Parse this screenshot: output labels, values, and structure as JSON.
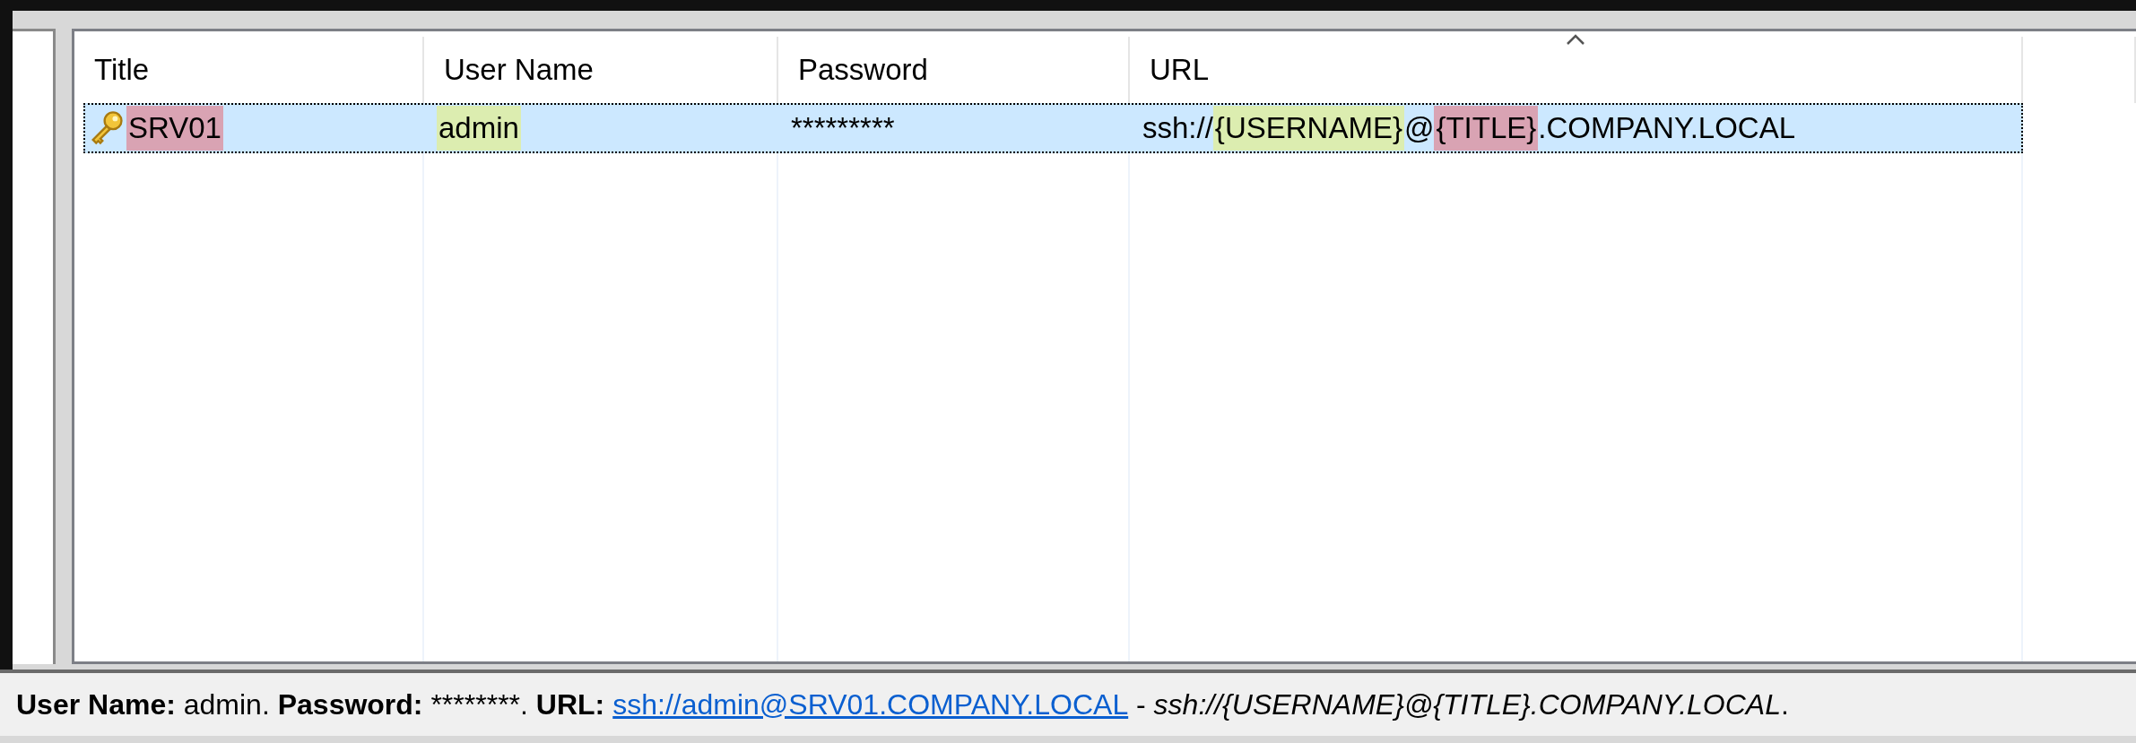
{
  "columns": [
    {
      "label": "Title",
      "sorted": false
    },
    {
      "label": "User Name",
      "sorted": false
    },
    {
      "label": "Password",
      "sorted": false
    },
    {
      "label": "URL",
      "sorted": true
    }
  ],
  "rows": [
    {
      "selected": true,
      "cells": [
        {
          "kind": "entry",
          "segments": [
            {
              "text": "SRV01",
              "color": "#d9a3b3"
            }
          ]
        },
        {
          "kind": "text",
          "segments": [
            {
              "text": "admin",
              "color": "#dcedb0"
            }
          ]
        },
        {
          "kind": "text",
          "segments": [
            {
              "text": "*********"
            }
          ]
        },
        {
          "kind": "text",
          "segments": [
            {
              "text": "ssh://"
            },
            {
              "text": "{USERNAME}",
              "color": "#dcedb0"
            },
            {
              "text": "@"
            },
            {
              "text": "{TITLE}",
              "color": "#d9a3b3"
            },
            {
              "text": ".COMPANY.LOCAL"
            }
          ]
        }
      ]
    }
  ],
  "status_bar": {
    "segments": [
      {
        "kind": "bold",
        "text": "User Name:"
      },
      {
        "kind": "plain",
        "text": " admin. "
      },
      {
        "kind": "bold",
        "text": "Password:"
      },
      {
        "kind": "plain",
        "text": " ********. "
      },
      {
        "kind": "bold",
        "text": "URL:"
      },
      {
        "kind": "link",
        "text": "ssh://admin@SRV01.COMPANY.LOCAL"
      },
      {
        "kind": "plain",
        "text": " - "
      },
      {
        "kind": "italic",
        "text": "ssh://{USERNAME}@{TITLE}.COMPANY.LOCAL"
      },
      {
        "kind": "plain",
        "text": "."
      }
    ]
  }
}
